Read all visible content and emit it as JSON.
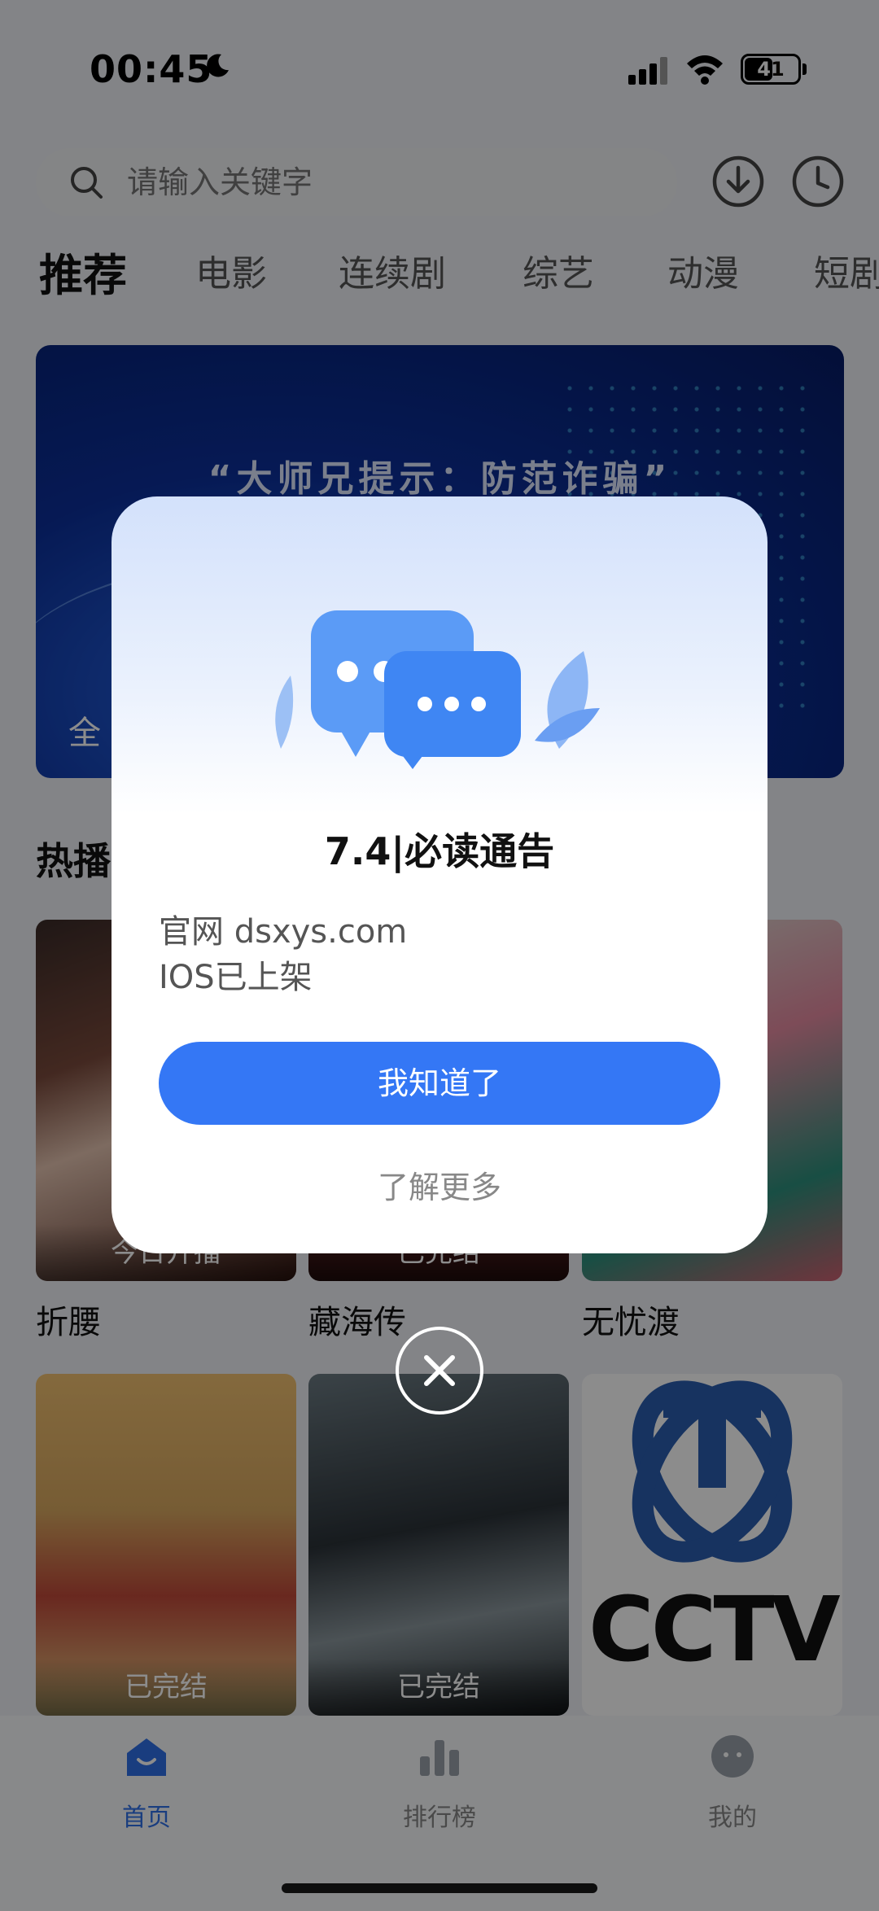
{
  "status_bar": {
    "time": "00:45",
    "battery": "41"
  },
  "search": {
    "placeholder": "请输入关键字"
  },
  "tabs": [
    {
      "label": "推荐",
      "active": true
    },
    {
      "label": "电影"
    },
    {
      "label": "连续剧"
    },
    {
      "label": "综艺"
    },
    {
      "label": "动漫"
    },
    {
      "label": "短剧"
    }
  ],
  "banner": {
    "title": "“大师兄提示：防范诈骗”",
    "label": "全"
  },
  "section": {
    "title": "热播"
  },
  "posters": [
    {
      "title": "折腰",
      "overlay": "今日开播"
    },
    {
      "title": "藏海传",
      "overlay": "已完结"
    },
    {
      "title": "无忧渡",
      "overlay": ""
    },
    {
      "title": "",
      "overlay": "已完结"
    },
    {
      "title": "",
      "overlay": "已完结"
    },
    {
      "title": "",
      "overlay": ""
    }
  ],
  "cctv": {
    "brand_a": "CC",
    "brand_b": "TV"
  },
  "bottom_nav": [
    {
      "label": "首页",
      "active": true
    },
    {
      "label": "排行榜"
    },
    {
      "label": "我的"
    }
  ],
  "dialog": {
    "title": "7.4|必读通告",
    "line1": "官网 dsxys.com",
    "line2": "IOS已上架",
    "confirm": "我知道了",
    "more": "了解更多"
  },
  "colors": {
    "accent": "#3477f5",
    "overlay": "rgba(0,0,0,0.45)"
  }
}
